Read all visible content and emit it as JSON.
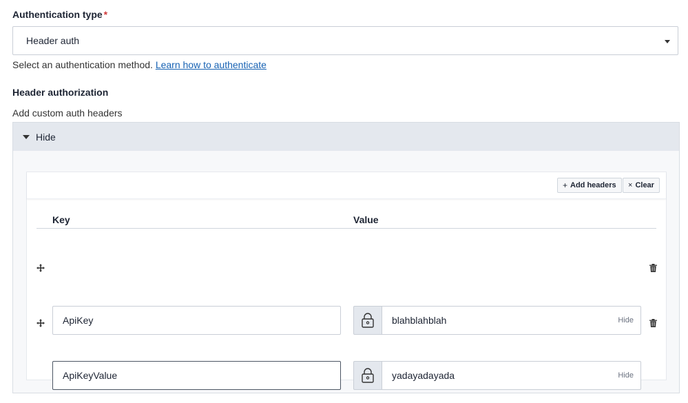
{
  "auth": {
    "label": "Authentication type",
    "required_mark": "*",
    "selected": "Header auth",
    "helper_text": "Select an authentication method.",
    "helper_link": "Learn how to authenticate"
  },
  "header_auth": {
    "title": "Header authorization",
    "subtitle": "Add custom auth headers",
    "toggle_label": "Hide",
    "toolbar": {
      "add_label": "Add headers",
      "clear_label": "Clear"
    },
    "columns": {
      "key": "Key",
      "value": "Value"
    },
    "rows": [
      {
        "key": "ApiKey",
        "value": "blahblahblah",
        "visibility_label": "Hide"
      },
      {
        "key": "ApiKeyValue",
        "value": "yadayadayada",
        "visibility_label": "Hide"
      }
    ]
  },
  "colors": {
    "link": "#1762b3",
    "required": "#d03b3b",
    "panel_header": "#e4e8ee"
  },
  "icons": [
    "caret-down-icon",
    "triangle-down-icon",
    "plus-icon",
    "close-icon",
    "drag-handle-icon",
    "lock-icon",
    "trash-icon"
  ]
}
